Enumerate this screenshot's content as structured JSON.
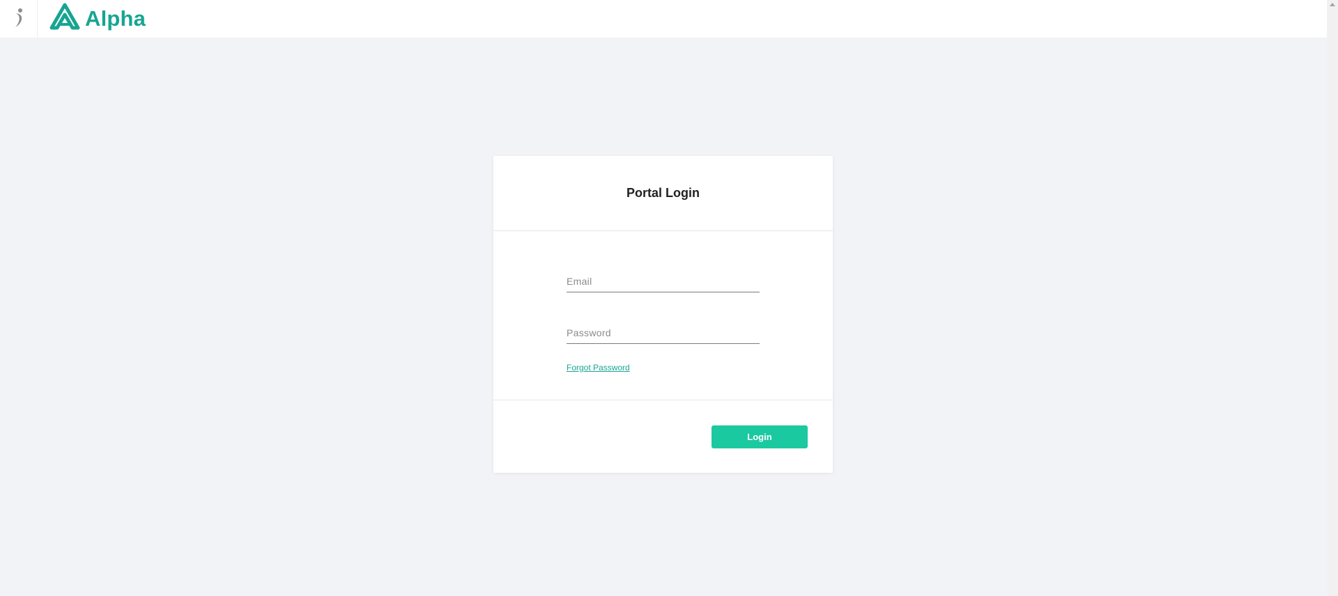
{
  "header": {
    "brand_name": "Alpha",
    "brand_color": "#17a592",
    "side_logo_icon": "figure-icon",
    "brand_logo_icon": "alpha-logo-icon"
  },
  "login_card": {
    "title": "Portal Login",
    "email_placeholder": "Email",
    "email_value": "",
    "password_placeholder": "Password",
    "password_value": "",
    "forgot_password_label": "Forgot Password",
    "login_button_label": "Login",
    "button_color": "#1bc9a0"
  }
}
